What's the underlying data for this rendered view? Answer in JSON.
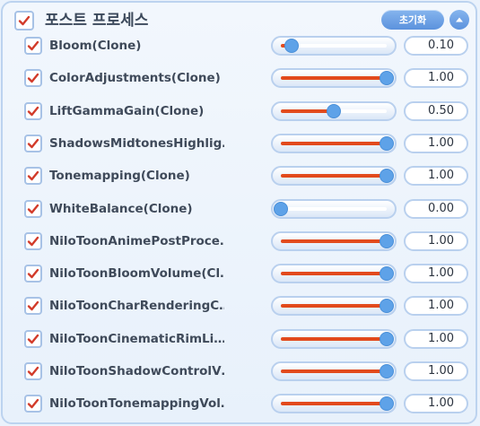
{
  "header": {
    "title": "포스트 프로세스",
    "reset_label": "초기화",
    "enabled": true
  },
  "colors": {
    "accent": "#5b92dd",
    "fill": "#e24a1c",
    "check": "#d23b2a"
  },
  "icons": {
    "check": "checkmark-icon",
    "collapse": "chevron-up-icon"
  },
  "effects": [
    {
      "name": "Bloom(Clone)",
      "value": "0.10",
      "level": 0.1,
      "enabled": true
    },
    {
      "name": "ColorAdjustments(Clone)",
      "value": "1.00",
      "level": 1.0,
      "enabled": true
    },
    {
      "name": "LiftGammaGain(Clone)",
      "value": "0.50",
      "level": 0.5,
      "enabled": true
    },
    {
      "name": "ShadowsMidtonesHighlig…",
      "value": "1.00",
      "level": 1.0,
      "enabled": true
    },
    {
      "name": "Tonemapping(Clone)",
      "value": "1.00",
      "level": 1.0,
      "enabled": true
    },
    {
      "name": "WhiteBalance(Clone)",
      "value": "0.00",
      "level": 0.0,
      "enabled": true
    },
    {
      "name": "NiloToonAnimePostProce…",
      "value": "1.00",
      "level": 1.0,
      "enabled": true
    },
    {
      "name": "NiloToonBloomVolume(Cl…",
      "value": "1.00",
      "level": 1.0,
      "enabled": true
    },
    {
      "name": "NiloToonCharRenderingC…",
      "value": "1.00",
      "level": 1.0,
      "enabled": true
    },
    {
      "name": "NiloToonCinematicRimLi…",
      "value": "1.00",
      "level": 1.0,
      "enabled": true
    },
    {
      "name": "NiloToonShadowControlV…",
      "value": "1.00",
      "level": 1.0,
      "enabled": true
    },
    {
      "name": "NiloToonTonemappingVol…",
      "value": "1.00",
      "level": 1.0,
      "enabled": true
    }
  ]
}
